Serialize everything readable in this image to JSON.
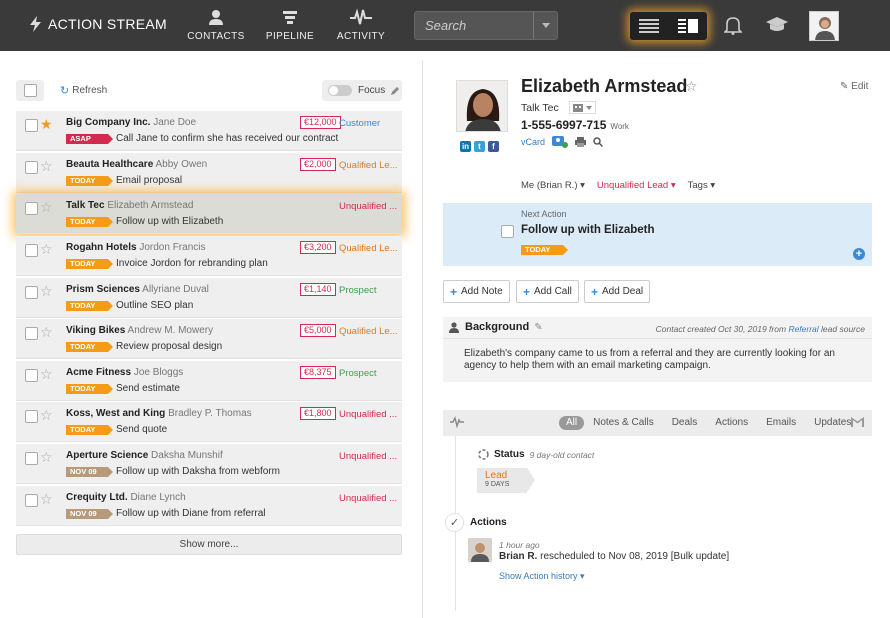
{
  "header": {
    "brand": "ACTION STREAM",
    "nav": [
      {
        "label": "CONTACTS",
        "icon": "person-icon"
      },
      {
        "label": "PIPELINE",
        "icon": "funnel-icon"
      },
      {
        "label": "ACTIVITY",
        "icon": "pulse-icon"
      }
    ],
    "search_placeholder": "Search"
  },
  "toolbar": {
    "refresh_label": "Refresh",
    "focus_label": "Focus"
  },
  "list": [
    {
      "company": "Big Company Inc.",
      "person": "Jane Doe",
      "amount": "€12,000",
      "status": "Customer",
      "status_color": "#3a8ad6",
      "tag": "ASAP",
      "tag_color": "#d32b4f",
      "task": "Call Jane to confirm she has received our contract",
      "starred": true
    },
    {
      "company": "Beauta Healthcare",
      "person": "Abby Owen",
      "amount": "€2,000",
      "status": "Qualified Le...",
      "status_color": "#e2781c",
      "tag": "TODAY",
      "tag_color": "#f59b16",
      "task": "Email proposal",
      "starred": false
    },
    {
      "company": "Talk Tec",
      "person": "Elizabeth Armstead",
      "amount": "",
      "status": "Unqualified ...",
      "status_color": "#d32b4f",
      "tag": "TODAY",
      "tag_color": "#f59b16",
      "task": "Follow up with Elizabeth",
      "starred": false,
      "selected": true
    },
    {
      "company": "Rogahn Hotels",
      "person": "Jordon Francis",
      "amount": "€3,200",
      "status": "Qualified Le...",
      "status_color": "#e2781c",
      "tag": "TODAY",
      "tag_color": "#f59b16",
      "task": "Invoice Jordon for rebranding plan",
      "starred": false
    },
    {
      "company": "Prism Sciences",
      "person": "Allyriane Duval",
      "amount": "€1,140",
      "status": "Prospect",
      "status_color": "#3aa04a",
      "tag": "TODAY",
      "tag_color": "#f59b16",
      "task": "Outline SEO plan",
      "starred": false
    },
    {
      "company": "Viking Bikes",
      "person": "Andrew M. Mowery",
      "amount": "€5,000",
      "status": "Qualified Le...",
      "status_color": "#e2781c",
      "tag": "TODAY",
      "tag_color": "#f59b16",
      "task": "Review proposal design",
      "starred": false
    },
    {
      "company": "Acme Fitness",
      "person": "Joe Bloggs",
      "amount": "€8,375",
      "status": "Prospect",
      "status_color": "#3aa04a",
      "tag": "TODAY",
      "tag_color": "#f59b16",
      "task": "Send estimate",
      "starred": false
    },
    {
      "company": "Koss, West and King",
      "person": "Bradley P. Thomas",
      "amount": "€1,800",
      "status": "Unqualified ...",
      "status_color": "#d32b4f",
      "tag": "TODAY",
      "tag_color": "#f59b16",
      "task": "Send quote",
      "starred": false
    },
    {
      "company": "Aperture Science",
      "person": "Daksha Munshif",
      "amount": "",
      "status": "Unqualified ...",
      "status_color": "#d32b4f",
      "tag": "NOV 09",
      "tag_color": "#b79a7a",
      "task": "Follow up with Daksha from webform",
      "starred": false
    },
    {
      "company": "Crequity Ltd.",
      "person": "Diane Lynch",
      "amount": "",
      "status": "Unqualified ...",
      "status_color": "#d32b4f",
      "tag": "NOV 09",
      "tag_color": "#b79a7a",
      "task": "Follow up with Diane from referral",
      "starred": false
    }
  ],
  "show_more": "Show more...",
  "contact": {
    "name": "Elizabeth Armstead",
    "edit_label": "Edit",
    "org": "Talk Tec",
    "phone": "1-555-6997-715",
    "phone_type": "Work",
    "vcard": "vCard",
    "owner": "Me (Brian R.)",
    "stage": "Unqualified Lead",
    "tags": "Tags"
  },
  "next_action": {
    "label": "Next Action",
    "task": "Follow up with Elizabeth",
    "tag": "TODAY"
  },
  "action_buttons": [
    "Add Note",
    "Add Call",
    "Add Deal"
  ],
  "background": {
    "title": "Background",
    "meta_prefix": "Contact created Oct 30, 2019 from",
    "meta_source": "Referral",
    "meta_suffix": "lead source",
    "text": "Elizabeth's company came to us from a referral and they are currently looking for an agency to help them with an email marketing campaign."
  },
  "feed": {
    "tabs": [
      "All",
      "Notes & Calls",
      "Deals",
      "Actions",
      "Emails",
      "Updates"
    ],
    "status_title": "Status",
    "status_sub": "9 day-old contact",
    "lead_label": "Lead",
    "lead_days": "9 DAYS",
    "actions_title": "Actions",
    "act_time": "1 hour ago",
    "act_user": "Brian R.",
    "act_text": "rescheduled to Nov 08, 2019 [Bulk update]",
    "act_history": "Show Action history"
  },
  "colors": {
    "accent_blue": "#3a8ad6",
    "danger_red": "#d32b4f",
    "today_orange": "#f59b16",
    "topbar": "#3a3a3a"
  }
}
